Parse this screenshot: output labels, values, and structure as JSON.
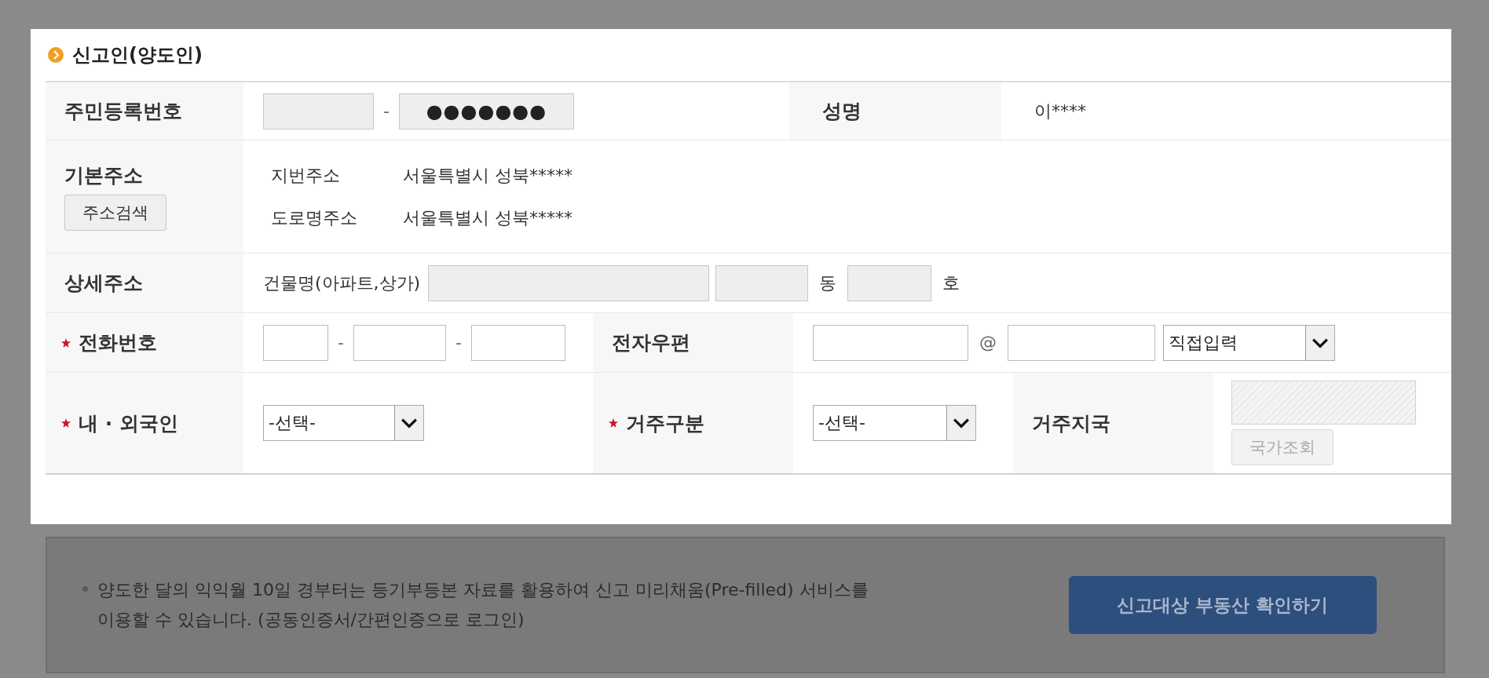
{
  "section_title": "신고인(양도인)",
  "resident": {
    "label": {
      "text": "주민등록번호",
      "required": false
    },
    "separator": "-",
    "back_masked": "●●●●●●●"
  },
  "name": {
    "label": {
      "text": "성명",
      "required": false
    },
    "value": "이****"
  },
  "basic_address": {
    "label": {
      "text": "기본주소",
      "required": false
    },
    "button": "주소검색",
    "lines": [
      {
        "label": "지번주소",
        "value": "서울특별시 성북*****"
      },
      {
        "label": "도로명주소",
        "value": "서울특별시 성북*****"
      }
    ]
  },
  "detail_address": {
    "label": {
      "text": "상세주소",
      "required": false
    },
    "building_label": "건물명(아파트,상가)",
    "dong": "동",
    "ho": "호"
  },
  "phone": {
    "label": {
      "text": "전화번호",
      "required": true
    },
    "separators": [
      "-",
      "-"
    ]
  },
  "email": {
    "label": {
      "text": "전자우편",
      "required": false
    },
    "at": "@",
    "domain_select": "직접입력"
  },
  "nationality": {
    "label": {
      "text": "내 · 외국인",
      "required": true
    },
    "select": "-선택-"
  },
  "residency": {
    "label": {
      "text": "거주구분",
      "required": true
    },
    "select": "-선택-"
  },
  "country": {
    "label": {
      "text": "거주지국",
      "required": false
    },
    "disabled": true,
    "button": "국가조회"
  },
  "notice": "양도한 달의 익익월 10일 경부터는 등기부등본 자료를 활용하여 신고 미리채움(Pre-filled) 서비스를 이용할 수 있습니다. (공동인증서/간편인증으로 로그인)",
  "check_button": "신고대상 부동산 확인하기"
}
